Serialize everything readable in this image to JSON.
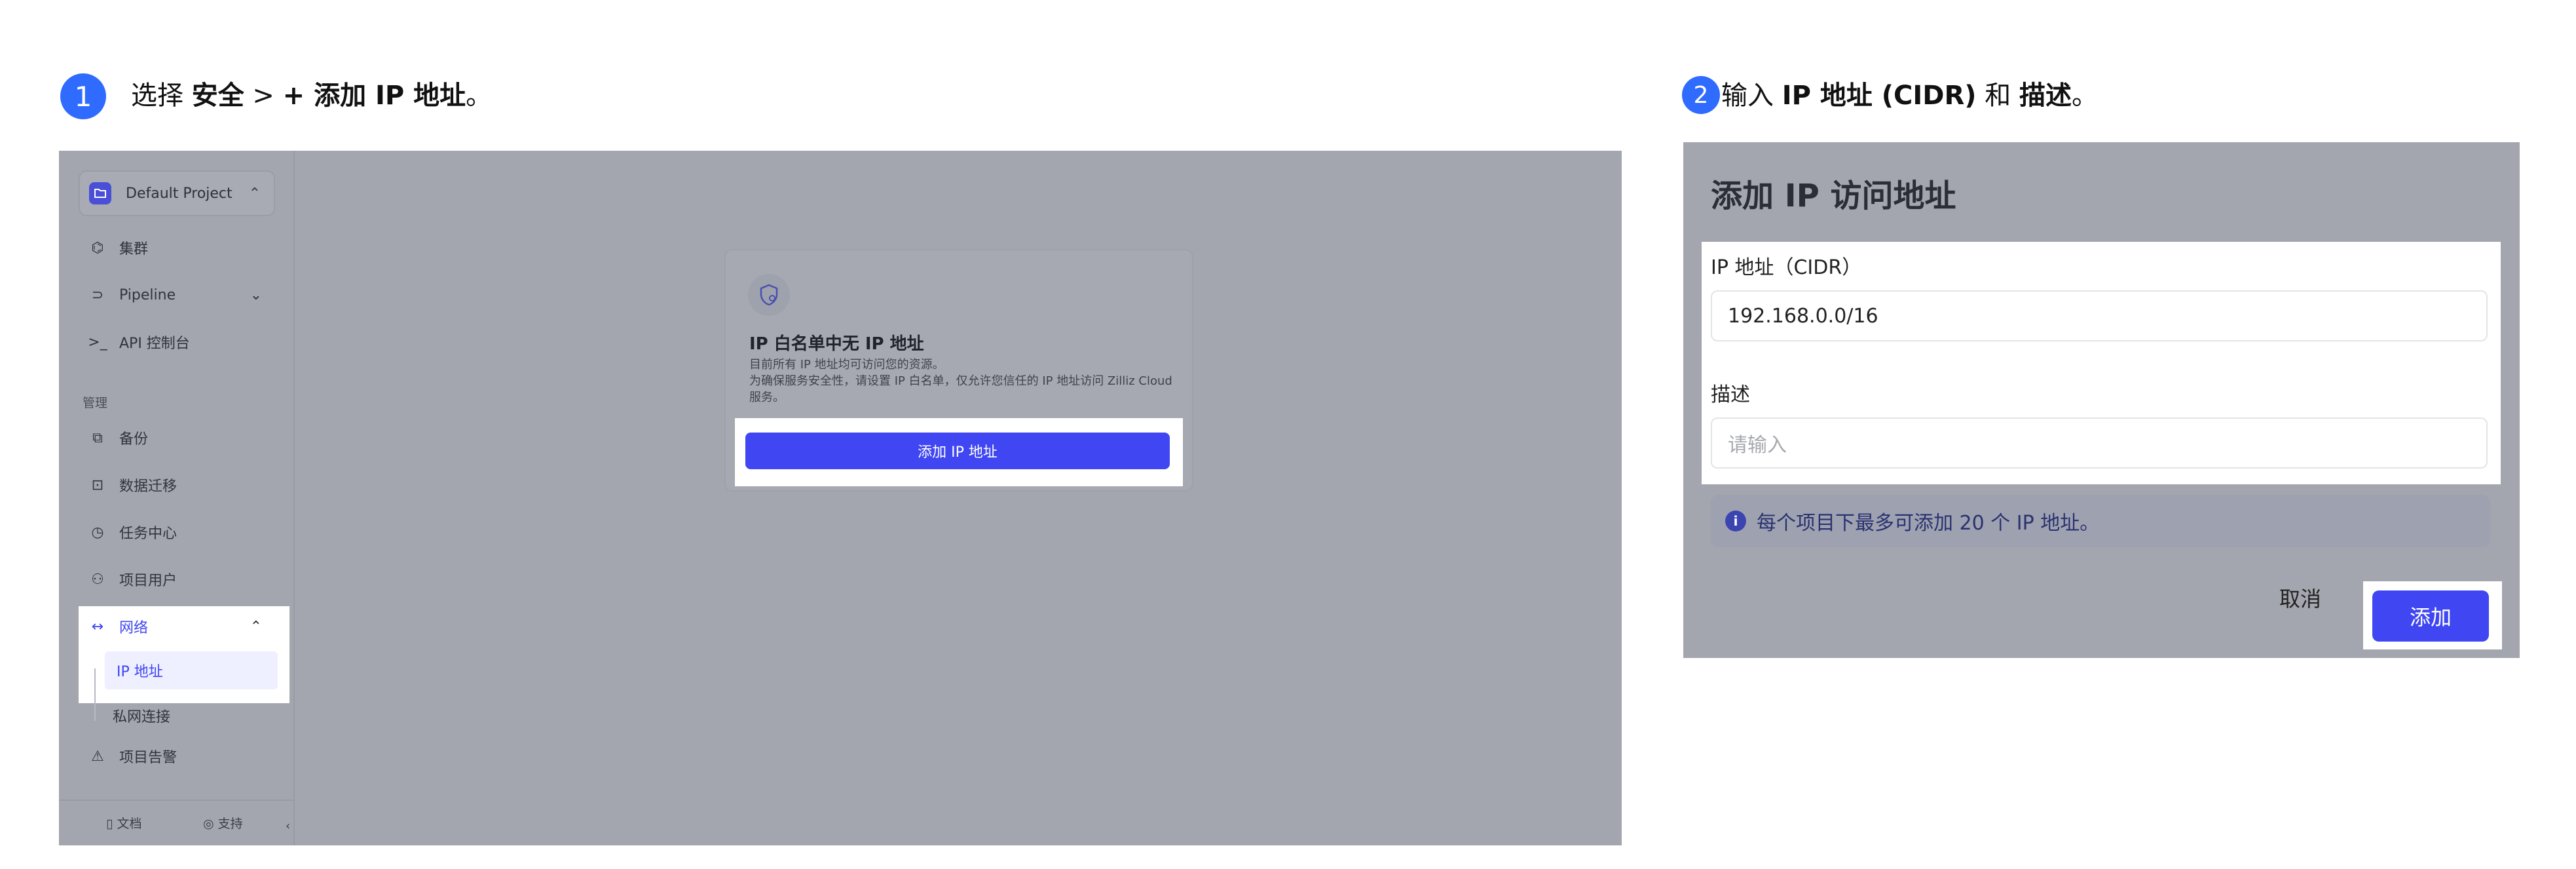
{
  "step1": {
    "number": "1",
    "text_prefix": "选择 ",
    "text_bold1": "安全",
    "text_sep": " > ",
    "text_bold2": "+ 添加 IP 地址",
    "text_suffix": "。"
  },
  "step2": {
    "number": "2",
    "text_prefix": "输入 ",
    "text_bold1": "IP 地址 (CIDR)",
    "text_mid": " 和 ",
    "text_bold2": "描述",
    "text_suffix": "。"
  },
  "sidebar": {
    "project": "Default Project",
    "items": [
      {
        "icon": "cluster-icon",
        "label": "集群"
      },
      {
        "icon": "pipeline-icon",
        "label": "Pipeline"
      },
      {
        "icon": "terminal-icon",
        "label": "API 控制台"
      }
    ],
    "section_manage": "管理",
    "manage_items": [
      {
        "icon": "backup-icon",
        "label": "备份"
      },
      {
        "icon": "migration-icon",
        "label": "数据迁移"
      },
      {
        "icon": "task-icon",
        "label": "任务中心"
      },
      {
        "icon": "users-icon",
        "label": "项目用户"
      }
    ],
    "network": "网络",
    "ip_address": "IP 地址",
    "private_link": "私网连接",
    "alerts": "项目告警",
    "footer_docs": "文档",
    "footer_support": "支持"
  },
  "empty_state": {
    "title": "IP 白名单中无 IP 地址",
    "desc_line1": "目前所有 IP 地址均可访问您的资源。",
    "desc_line2": "为确保服务安全性，请设置 IP 白名单，仅允许您信任的 IP 地址访问 Zilliz Cloud 服务。",
    "button": "添加 IP 地址"
  },
  "dialog": {
    "title": "添加 IP 访问地址",
    "ip_label": "IP 地址（CIDR）",
    "ip_value": "192.168.0.0/16",
    "desc_label": "描述",
    "desc_placeholder": "请输入",
    "info": "每个项目下最多可添加 20 个 IP 地址。",
    "cancel": "取消",
    "add": "添加"
  },
  "colors": {
    "accent": "#3f46f2",
    "badge": "#2f6bff",
    "overlay": "#a3a6ae"
  }
}
